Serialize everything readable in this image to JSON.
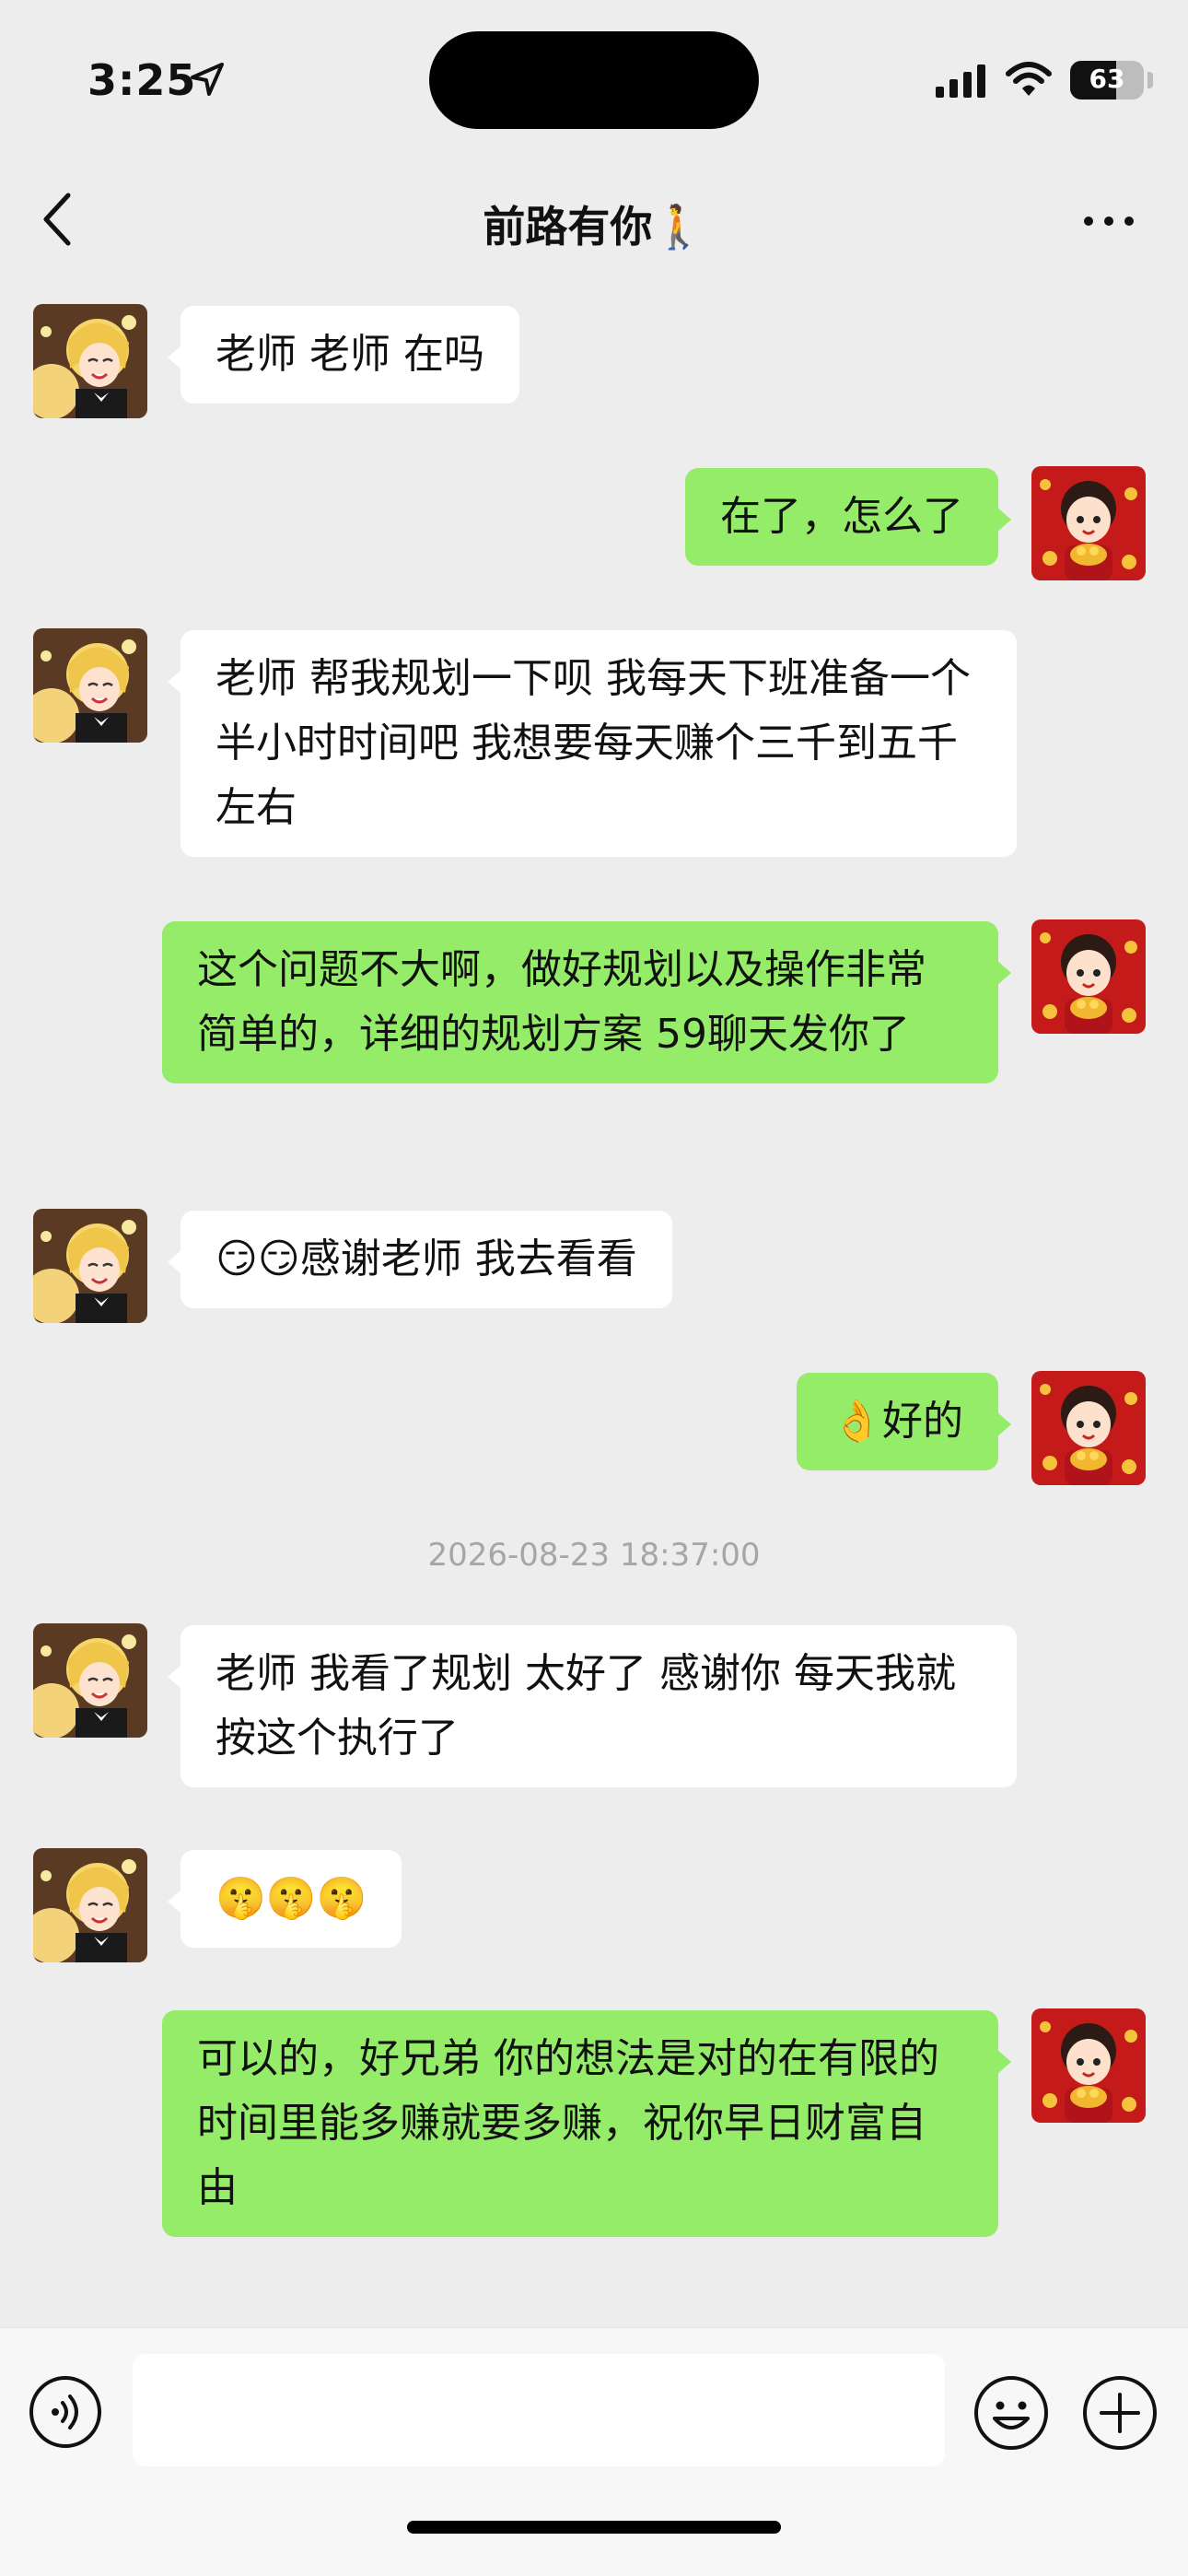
{
  "status_bar": {
    "time": "3:25",
    "battery": "63",
    "battery_level": 0.63
  },
  "nav": {
    "title": "前路有你🚶"
  },
  "messages": [
    {
      "side": "in",
      "text": "老师 老师 在吗"
    },
    {
      "side": "out",
      "text": "在了，怎么了"
    },
    {
      "side": "in",
      "text": "老师 帮我规划一下呗 我每天下班准备一个半小时时间吧 我想要每天赚个三千到五千左右"
    },
    {
      "side": "out",
      "text": "这个问题不大啊，做好规划以及操作非常简单的，详细的规划方案 59聊天发你了"
    },
    {
      "side": "in",
      "text": "😏😏感谢老师 我去看看"
    },
    {
      "side": "out",
      "text": "👌好的"
    },
    {
      "side": "in",
      "text": "老师 我看了规划 太好了 感谢你 每天我就按这个执行了"
    },
    {
      "side": "in",
      "text": "🤫🤫🤫"
    },
    {
      "side": "out",
      "text": "可以的，好兄弟 你的想法是对的在有限的时间里能多赚就要多赚，祝你早日财富自由"
    }
  ],
  "timestamp": "2026-08-23 18:37:00",
  "icons": {
    "back": "chevron-left-icon",
    "more": "more-dots-icon",
    "voice": "voice-icon",
    "emoji": "emoji-icon",
    "plus": "plus-icon"
  },
  "colors": {
    "background": "#ededed",
    "incoming_bubble": "#ffffff",
    "outgoing_bubble": "#95ec69"
  }
}
